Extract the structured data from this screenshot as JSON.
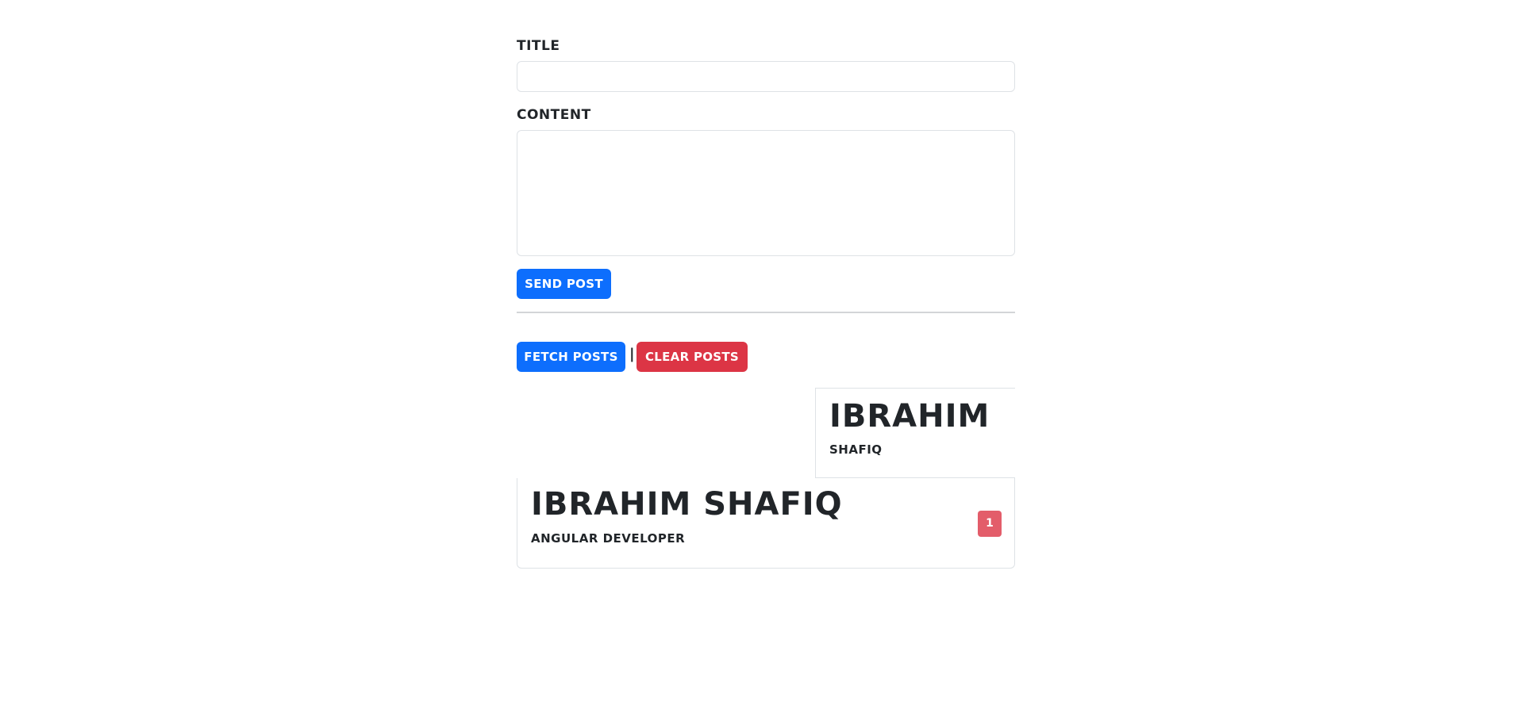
{
  "form": {
    "title_label": "Title",
    "title_value": "",
    "content_label": "Content",
    "content_value": "",
    "send_button": "Send Post"
  },
  "actions": {
    "fetch_button": "Fetch Posts",
    "separator": "|",
    "clear_button": "Clear Posts"
  },
  "posts": [
    {
      "title": "Ibrahim",
      "content": "Shafiq"
    },
    {
      "title": "Ibrahim Shafiq",
      "content": "Angular Developer",
      "badge": "1"
    }
  ],
  "colors": {
    "primary": "#0d6efd",
    "danger": "#dc3545",
    "badge": "#e35d6a",
    "text": "#212529",
    "border": "#dee2e6"
  }
}
